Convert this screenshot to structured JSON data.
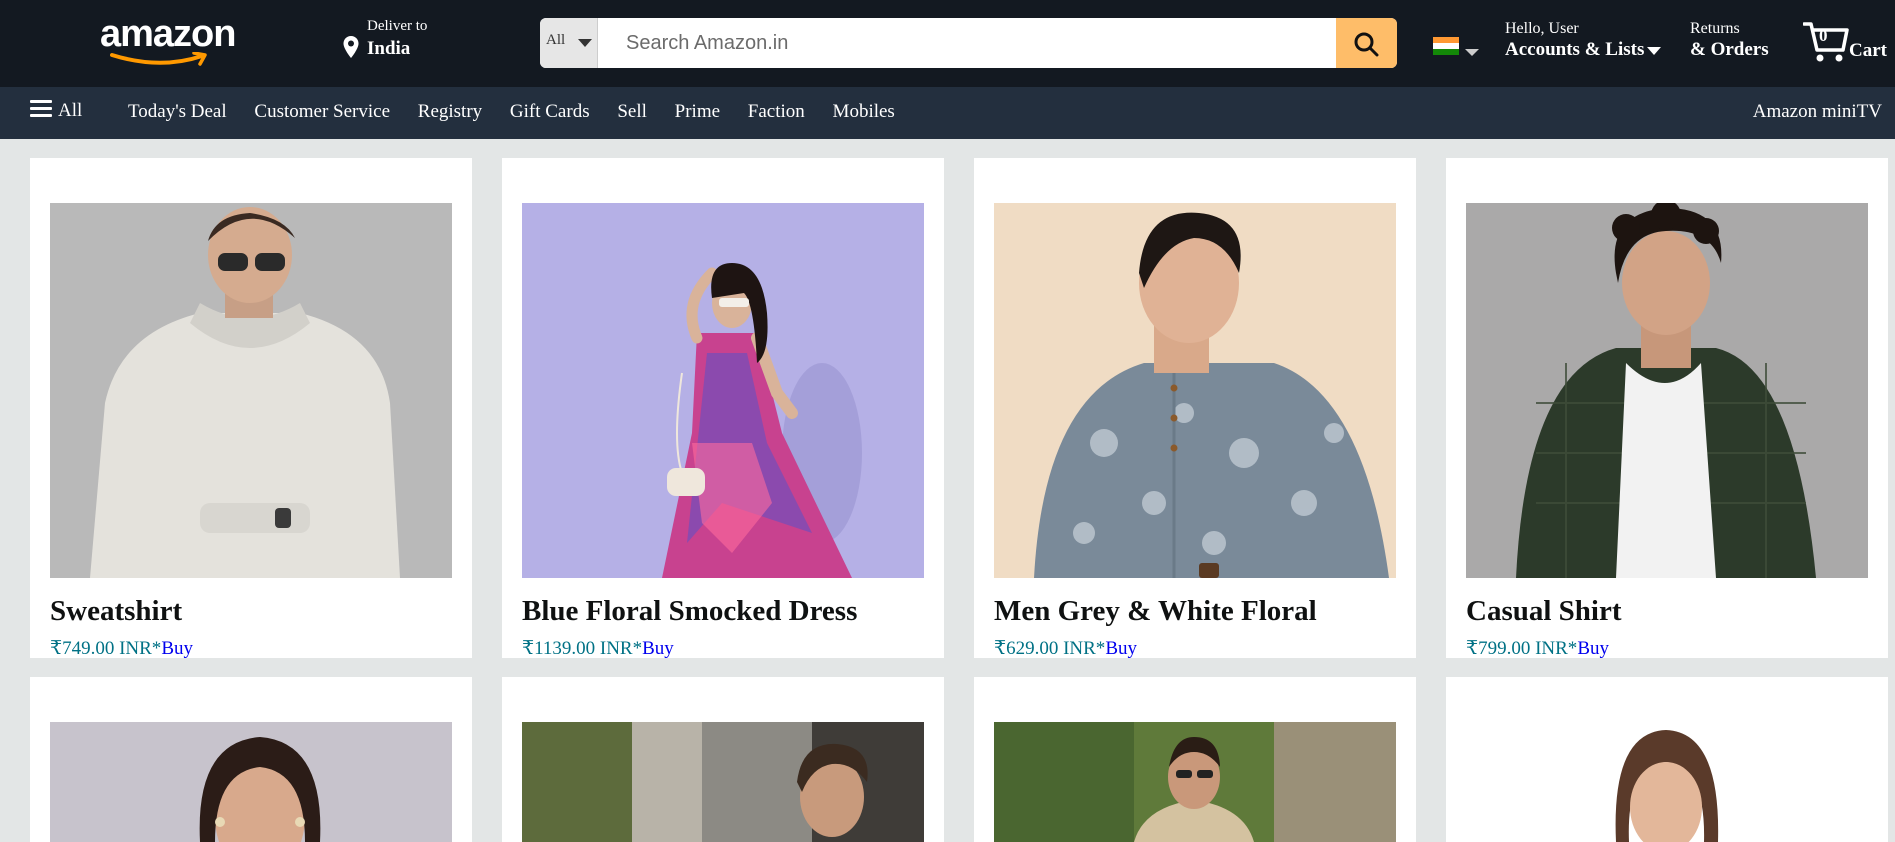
{
  "header": {
    "logo_text": "amazon",
    "deliver_label": "Deliver to",
    "deliver_location": "India",
    "search_category": "All",
    "search_placeholder": "Search Amazon.in",
    "greeting": "Hello, User",
    "accounts_label": "Accounts & Lists",
    "returns_label": "Returns",
    "orders_label": "& Orders",
    "cart_count": "0",
    "cart_label": "Cart",
    "colors": {
      "bg": "#131921",
      "search_button": "#febd69",
      "smile": "#ff9900"
    }
  },
  "nav": {
    "all_label": "All",
    "links": [
      "Today's Deal",
      "Customer Service",
      "Registry",
      "Gift Cards",
      "Sell",
      "Prime",
      "Faction",
      "Mobiles"
    ],
    "right_label": "Amazon miniTV",
    "bg": "#232f3e"
  },
  "products": [
    {
      "title": "Sweatshirt",
      "price": "₹749.00 INR*",
      "buy": "Buy"
    },
    {
      "title": "Blue Floral Smocked Dress",
      "price": "₹1139.00 INR*",
      "buy": "Buy"
    },
    {
      "title": "Men Grey & White Floral",
      "price": "₹629.00 INR*",
      "buy": "Buy"
    },
    {
      "title": "Casual Shirt",
      "price": "₹799.00 INR*",
      "buy": "Buy"
    }
  ]
}
